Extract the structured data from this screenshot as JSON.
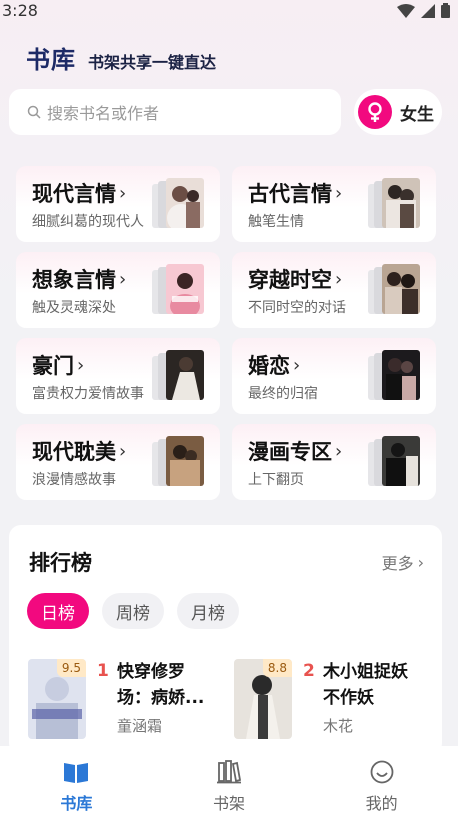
{
  "status_bar": {
    "time": "3:28"
  },
  "header": {
    "brand": "书库",
    "slogan": "书架共享一键直达"
  },
  "search": {
    "placeholder": "搜索书名或作者"
  },
  "gender": {
    "label": "女生",
    "accent": "#f2097f"
  },
  "categories": [
    {
      "title": "现代言情",
      "subtitle": "细腻纠葛的现代人"
    },
    {
      "title": "古代言情",
      "subtitle": "触笔生情"
    },
    {
      "title": "想象言情",
      "subtitle": "触及灵魂深处"
    },
    {
      "title": "穿越时空",
      "subtitle": "不同时空的对话"
    },
    {
      "title": "豪门",
      "subtitle": "富贵权力爱情故事"
    },
    {
      "title": "婚恋",
      "subtitle": "最终的归宿"
    },
    {
      "title": "现代耽美",
      "subtitle": "浪漫情感故事"
    },
    {
      "title": "漫画专区",
      "subtitle": "上下翻页"
    }
  ],
  "ranking": {
    "title": "排行榜",
    "more": "更多",
    "tabs": [
      {
        "label": "日榜",
        "active": true
      },
      {
        "label": "周榜",
        "active": false
      },
      {
        "label": "月榜",
        "active": false
      }
    ],
    "items": [
      {
        "rank": "1",
        "name": "快穿修罗场：病娇...",
        "author": "童涵霜",
        "score": "9.5",
        "cover_text": "病娇反派他真香"
      },
      {
        "rank": "2",
        "name": "木小姐捉妖不作妖",
        "author": "木花",
        "score": "8.8",
        "cover_text": ""
      }
    ]
  },
  "bottom_nav": [
    {
      "label": "书库",
      "icon": "book-open-icon",
      "active": true
    },
    {
      "label": "书架",
      "icon": "bookshelf-icon",
      "active": false
    },
    {
      "label": "我的",
      "icon": "smiley-icon",
      "active": false
    }
  ],
  "colors": {
    "brand": "#1d2a66",
    "accent": "#f2097f",
    "nav_active": "#2b78d6",
    "rank_number": "#e8534f"
  }
}
